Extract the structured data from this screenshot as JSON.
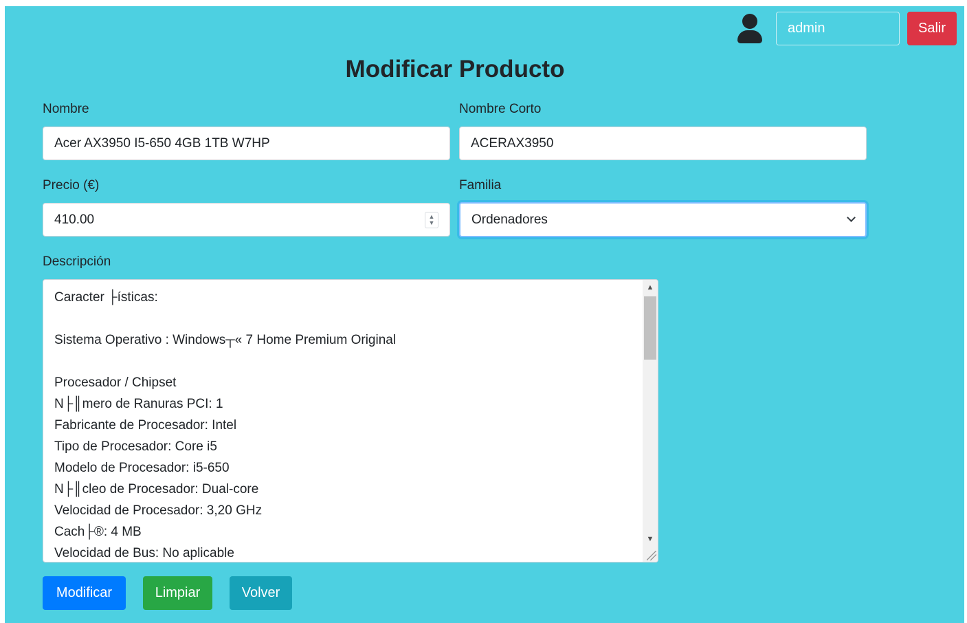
{
  "header": {
    "username": "admin",
    "logout_label": "Salir"
  },
  "page_title": "Modificar Producto",
  "form": {
    "nombre": {
      "label": "Nombre",
      "value": "Acer AX3950 I5-650 4GB 1TB W7HP"
    },
    "nombre_corto": {
      "label": "Nombre Corto",
      "value": "ACERAX3950"
    },
    "precio": {
      "label": "Precio (€)",
      "value": "410.00"
    },
    "familia": {
      "label": "Familia",
      "selected": "Ordenadores"
    },
    "descripcion": {
      "label": "Descripción",
      "lines": [
        "Caracter ├ísticas:",
        "",
        "Sistema Operativo : Windows┬« 7 Home Premium Original",
        "",
        "Procesador / Chipset",
        "N├║mero de Ranuras PCI: 1",
        "Fabricante de Procesador: Intel",
        "Tipo de Procesador: Core i5",
        "Modelo de Procesador: i5-650",
        "N├║cleo de Procesador: Dual-core",
        "Velocidad de Procesador: 3,20 GHz",
        "Cach├®: 4 MB",
        "Velocidad de Bus: No aplicable"
      ]
    }
  },
  "actions": {
    "modificar": "Modificar",
    "limpiar": "Limpiar",
    "volver": "Volver"
  },
  "colors": {
    "background": "#4dd0e1",
    "primary": "#007bff",
    "success": "#28a745",
    "info": "#17a2b8",
    "danger": "#dc3545"
  },
  "icons": {
    "user": "user-icon",
    "spinner": "spinner-icon",
    "dropdown": "chevron-down-icon"
  }
}
